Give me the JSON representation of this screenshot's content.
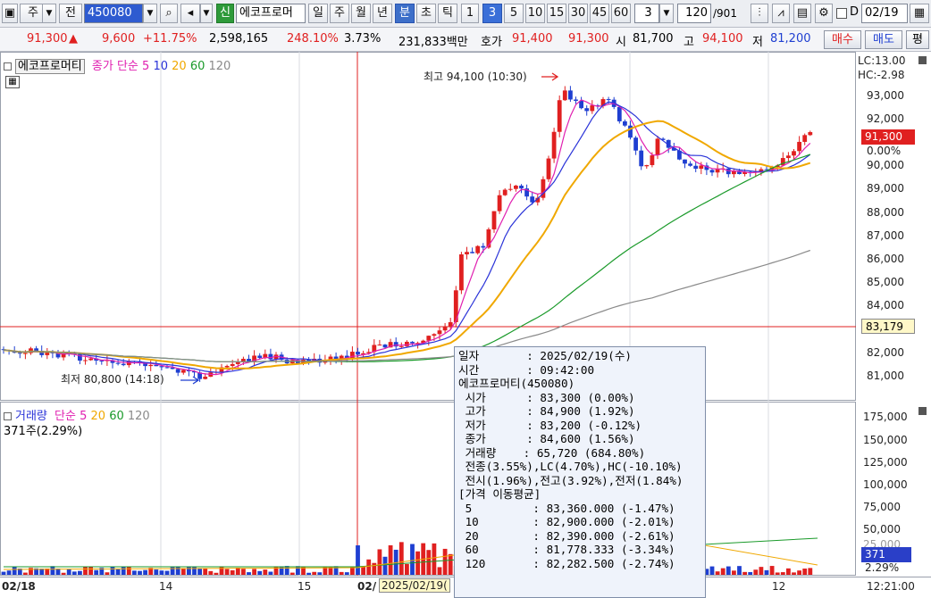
{
  "toolbar": {
    "type1": "주",
    "type2": "전",
    "code": "450080",
    "badge": "신",
    "name": "에코프로머",
    "period_buttons": [
      "일",
      "주",
      "월",
      "년",
      "분",
      "초",
      "틱"
    ],
    "period_selected": "분",
    "interval_buttons": [
      "1",
      "3",
      "5",
      "10",
      "15",
      "30",
      "45",
      "60"
    ],
    "interval_selected": "3",
    "interval_value": "3",
    "count_display": "120",
    "count_total": "/901",
    "date": "02/19",
    "d_label": "D"
  },
  "quote": {
    "price": "91,300",
    "change_arrow": "▲",
    "change": "9,600",
    "change_pct": "+11.75%",
    "volume": "2,598,165",
    "vol_ratio": "248.10%",
    "turnover": "3.73%",
    "amount": "231,833백만",
    "bid_label": "호가",
    "bid": "91,400",
    "ask": "91,300",
    "open_label": "시",
    "open": "81,700",
    "high_label": "고",
    "high": "94,100",
    "low_label": "저",
    "low": "81,200",
    "buy": "매수",
    "sell": "매도",
    "eval": "평"
  },
  "price_panel": {
    "legend_name": "에코프로머티",
    "legend_ma": "종가 단순",
    "legend_periods": [
      "5",
      "10",
      "20",
      "60",
      "120"
    ],
    "lc": "LC:13.00",
    "hc": "HC:-2.98",
    "current_price": "91,300",
    "current_pct": "0.00%",
    "crosshair_price": "83,179",
    "high_annotation": "최고 94,100 (10:30)",
    "low_annotation": "최저 80,800 (14:18)",
    "y_ticks": [
      "93,000",
      "92,000",
      "91,000",
      "90,000",
      "89,000",
      "88,000",
      "87,000",
      "86,000",
      "85,000",
      "84,000",
      "82,000",
      "81,000"
    ]
  },
  "volume_panel": {
    "legend_name": "거래량",
    "legend_ma": "단순",
    "legend_periods": [
      "5",
      "20",
      "60",
      "120"
    ],
    "current_label": "371주(2.29%)",
    "current_vol": "371",
    "current_pct": "2.29%",
    "y_ticks": [
      "175,000",
      "150,000",
      "125,000",
      "100,000",
      "75,000",
      "50,000",
      "25,000"
    ]
  },
  "x_axis": {
    "labels": [
      "02/18",
      "14",
      "15",
      "02/",
      "12"
    ],
    "cursor_label": "2025/02/19(",
    "time": "12:21:00"
  },
  "tooltip": {
    "rows": [
      "일자       : 2025/02/19(수)",
      "시간       : 09:42:00",
      "에코프로머티(450080)",
      " 시가      : 83,300 (0.00%)",
      " 고가      : 84,900 (1.92%)",
      " 저가      : 83,200 (-0.12%)",
      " 종가      : 84,600 (1.56%)",
      " 거래량    : 65,720 (684.80%)",
      " 전종(3.55%),LC(4.70%),HC(-10.10%)",
      " 전시(1.96%),전고(3.92%),전저(1.84%)",
      "[가격 이동평균]",
      " 5         : 83,360.000 (-1.47%)",
      " 10        : 82,900.000 (-2.01%)",
      " 20        : 82,390.000 (-2.61%)",
      " 60        : 81,778.333 (-3.34%)",
      " 120       : 82,282.500 (-2.74%)"
    ]
  },
  "colors": {
    "up": "#e02020",
    "down": "#1f3fd1",
    "ma5": "#e01fb0",
    "ma10": "#2a33d8",
    "ma20": "#f0a800",
    "ma60": "#1a9a2a",
    "ma120": "#8a8a8a"
  }
}
